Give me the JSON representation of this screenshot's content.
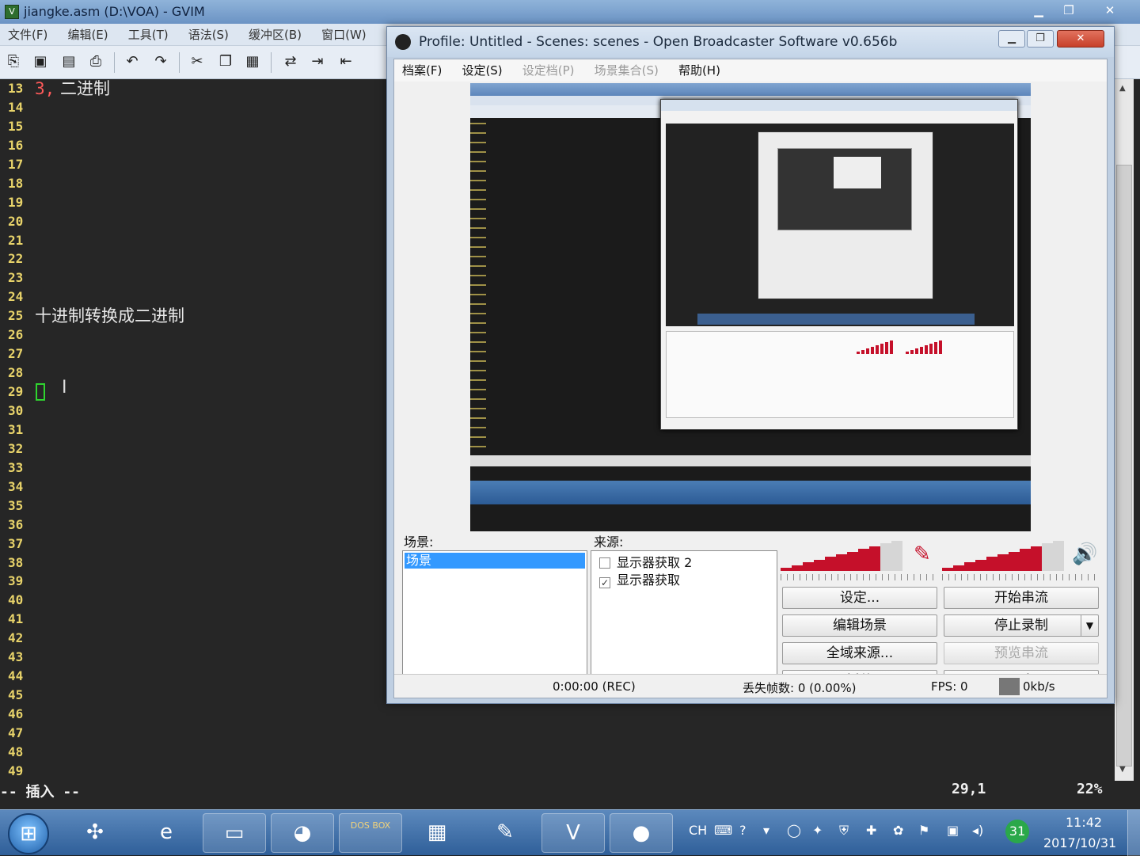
{
  "gvim": {
    "title": "jiangke.asm (D:\\VOA) - GVIM",
    "menu": [
      "文件(F)",
      "编辑(E)",
      "工具(T)",
      "语法(S)",
      "缓冲区(B)",
      "窗口(W)"
    ],
    "lines": [
      {
        "num": "13",
        "hl": "3,",
        "text": " 二进制"
      },
      {
        "num": "14",
        "hl": "",
        "text": ""
      },
      {
        "num": "15",
        "hl": "",
        "text": ""
      },
      {
        "num": "16",
        "hl": "",
        "text": ""
      },
      {
        "num": "17",
        "hl": "",
        "text": ""
      },
      {
        "num": "18",
        "hl": "",
        "text": ""
      },
      {
        "num": "19",
        "hl": "",
        "text": ""
      },
      {
        "num": "20",
        "hl": "",
        "text": ""
      },
      {
        "num": "21",
        "hl": "",
        "text": ""
      },
      {
        "num": "22",
        "hl": "",
        "text": ""
      },
      {
        "num": "23",
        "hl": "",
        "text": ""
      },
      {
        "num": "24",
        "hl": "",
        "text": ""
      },
      {
        "num": "25",
        "hl": "",
        "text": "十进制转换成二进制"
      },
      {
        "num": "26",
        "hl": "",
        "text": ""
      },
      {
        "num": "27",
        "hl": "",
        "text": ""
      },
      {
        "num": "28",
        "hl": "",
        "text": ""
      },
      {
        "num": "29",
        "hl": "",
        "text": ""
      },
      {
        "num": "30",
        "hl": "",
        "text": ""
      },
      {
        "num": "31",
        "hl": "",
        "text": ""
      },
      {
        "num": "32",
        "hl": "",
        "text": ""
      },
      {
        "num": "33",
        "hl": "",
        "text": ""
      },
      {
        "num": "34",
        "hl": "",
        "text": ""
      },
      {
        "num": "35",
        "hl": "",
        "text": ""
      },
      {
        "num": "36",
        "hl": "",
        "text": ""
      },
      {
        "num": "37",
        "hl": "",
        "text": ""
      },
      {
        "num": "38",
        "hl": "",
        "text": ""
      },
      {
        "num": "39",
        "hl": "",
        "text": ""
      },
      {
        "num": "40",
        "hl": "",
        "text": ""
      },
      {
        "num": "41",
        "hl": "",
        "text": ""
      },
      {
        "num": "42",
        "hl": "",
        "text": ""
      },
      {
        "num": "43",
        "hl": "",
        "text": ""
      },
      {
        "num": "44",
        "hl": "",
        "text": ""
      },
      {
        "num": "45",
        "hl": "",
        "text": ""
      },
      {
        "num": "46",
        "hl": "",
        "text": ""
      },
      {
        "num": "47",
        "hl": "",
        "text": ""
      },
      {
        "num": "48",
        "hl": "",
        "text": ""
      },
      {
        "num": "49",
        "hl": "",
        "text": ""
      }
    ],
    "status": {
      "mode": "-- 插入 --",
      "position": "29,1",
      "percent": "22%"
    }
  },
  "obs": {
    "title": "Profile: Untitled - Scenes: scenes - Open Broadcaster Software v0.656b",
    "menu": [
      "档案(F)",
      "设定(S)",
      "设定档(P)",
      "场景集合(S)",
      "帮助(H)"
    ],
    "scenes_label": "场景:",
    "scenes": [
      "场景"
    ],
    "sources_label": "来源:",
    "sources": [
      {
        "label": "显示器获取 2",
        "checked": false
      },
      {
        "label": "显示器获取",
        "checked": true
      }
    ],
    "buttons": {
      "settings": "设定...",
      "start_stream": "开始串流",
      "edit_scene": "编辑场景",
      "stop_record": "停止录制",
      "global_sources": "全域来源...",
      "preview_stream": "预览串流",
      "plugins": "插件",
      "exit": "退出"
    },
    "status": {
      "time": "0:00:00 (REC)",
      "dropped_frames": "丢失帧数: 0 (0.00%)",
      "fps": "FPS: 0",
      "bitrate": "0kb/s"
    },
    "mic_level": 0.78,
    "desktop_level": 0.82,
    "accent_color": "#c5102a"
  },
  "taskbar": {
    "apps": [
      "control-panel-icon",
      "ie-icon",
      "explorer-icon",
      "paint-icon",
      "dosbox-icon",
      "calculator-icon",
      "paint-brush-icon",
      "gvim-icon",
      "obs-icon"
    ],
    "dosbox_label": "DOS BOX",
    "tray_lang": "CH",
    "tray_badge": "31",
    "time": "11:42",
    "date": "2017/10/31"
  }
}
